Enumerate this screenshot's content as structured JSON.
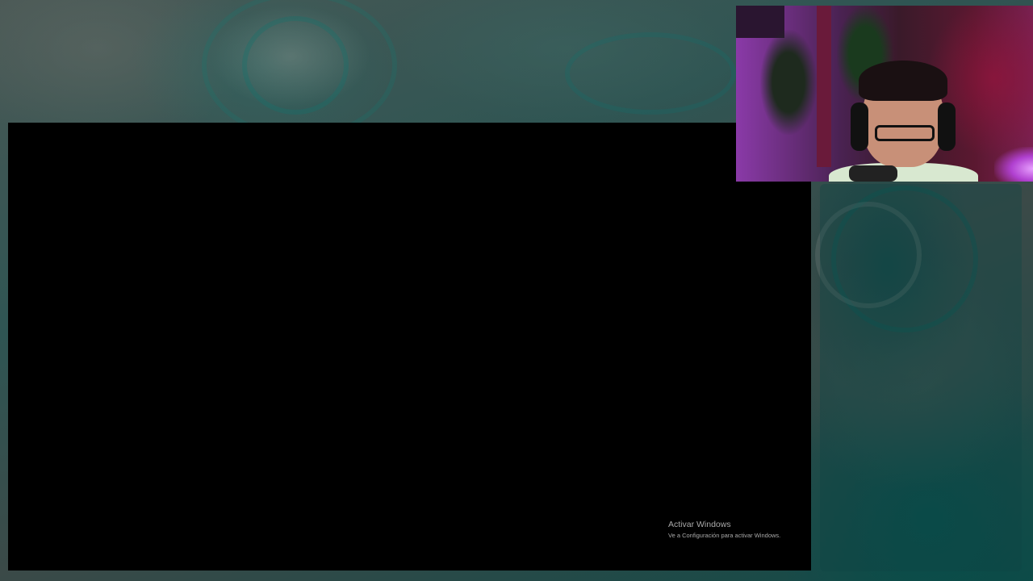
{
  "watermark": {
    "title": "Activar Windows",
    "subtitle": "Ve a Configuración para activar Windows."
  },
  "colors": {
    "background": "#2e4744",
    "screen": "#000000",
    "watermark_text": "#a9a9a9"
  }
}
